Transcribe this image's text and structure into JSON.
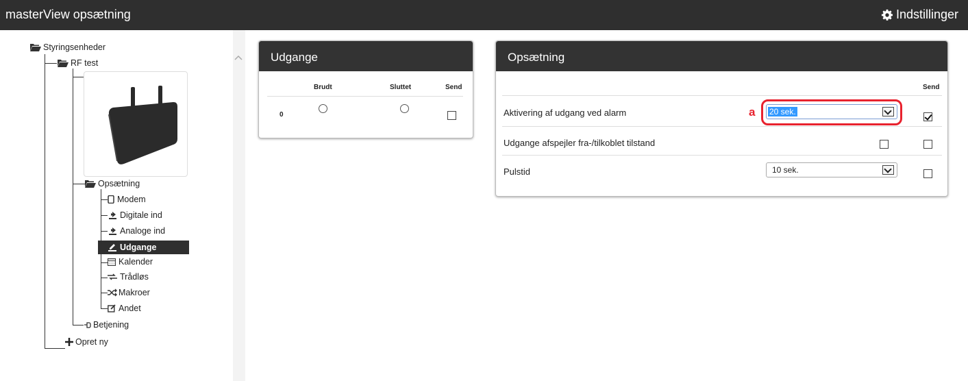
{
  "header": {
    "app_title": "masterView opsætning",
    "settings_label": "Indstillinger"
  },
  "tree": {
    "root": "Styringsenheder",
    "device": "RF test",
    "setup": "Opsætning",
    "items": [
      {
        "label": "Modem",
        "icon": "phone-icon"
      },
      {
        "label": "Digitale ind",
        "icon": "input-icon"
      },
      {
        "label": "Analoge ind",
        "icon": "input-icon"
      },
      {
        "label": "Udgange",
        "icon": "output-icon",
        "selected": true
      },
      {
        "label": "Kalender",
        "icon": "calendar-icon"
      },
      {
        "label": "Trådløs",
        "icon": "wireless-icon"
      },
      {
        "label": "Makroer",
        "icon": "shuffle-icon"
      },
      {
        "label": "Andet",
        "icon": "edit-icon"
      }
    ],
    "operation": "Betjening",
    "create_new": "Opret ny"
  },
  "udgange_panel": {
    "title": "Udgange",
    "columns": [
      "Brudt",
      "Sluttet",
      "Send"
    ],
    "rows": [
      {
        "num": "0",
        "brudt": false,
        "sluttet": false,
        "send": false
      }
    ]
  },
  "opsaetning_panel": {
    "title": "Opsætning",
    "send_header": "Send",
    "rows": [
      {
        "label": "Aktivering af udgang ved alarm",
        "select_value": "20 sek.",
        "send": true
      },
      {
        "label": "Udgange afspejler fra-/tilkoblet tilstand",
        "checkbox": false,
        "send": false
      },
      {
        "label": "Pulstid",
        "select_value": "10 sek.",
        "send": false
      }
    ]
  },
  "annotation": {
    "letter": "a",
    "color": "#e8222e"
  }
}
